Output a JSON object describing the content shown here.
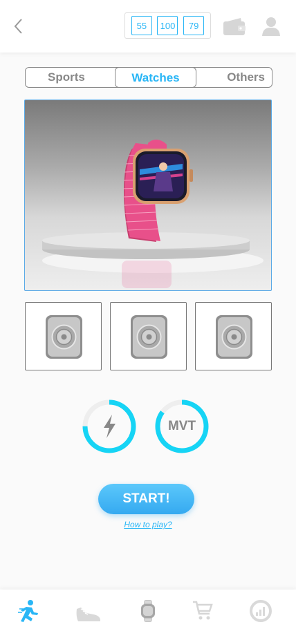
{
  "header": {
    "counters": [
      "55",
      "100",
      "79"
    ]
  },
  "category_tabs": [
    {
      "label": "Sports",
      "active": false
    },
    {
      "label": "Watches",
      "active": true
    },
    {
      "label": "Others",
      "active": false
    }
  ],
  "gauges": [
    {
      "icon": "lightning-icon",
      "label": "",
      "fill": 0.75,
      "color": "#16d4f5"
    },
    {
      "icon": "",
      "label": "MVT",
      "fill": 0.85,
      "color": "#16d4f5"
    }
  ],
  "actions": {
    "start_label": "START!",
    "how_to_play": "How to play?"
  },
  "bottom_nav": [
    {
      "icon": "runner-icon",
      "active": true
    },
    {
      "icon": "sneaker-icon",
      "active": false
    },
    {
      "icon": "watch-icon",
      "active": false
    },
    {
      "icon": "cart-icon",
      "active": false
    },
    {
      "icon": "stats-icon",
      "active": false
    }
  ],
  "colors": {
    "accent": "#29b6f6",
    "gauge": "#16d4f5",
    "band": "#e8508a"
  }
}
